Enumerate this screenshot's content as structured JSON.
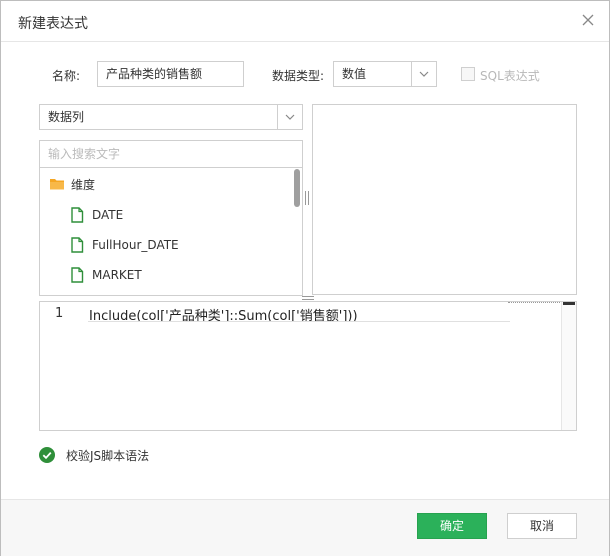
{
  "dialog": {
    "title": "新建表达式"
  },
  "form": {
    "name_label": "名称:",
    "name_value": "产品种类的销售额",
    "type_label": "数据类型:",
    "type_value": "数值",
    "sql_checkbox_label": "SQL表达式"
  },
  "source": {
    "selected": "数据列",
    "search_placeholder": "输入搜索文字"
  },
  "tree": {
    "folder": "维度",
    "items": [
      "DATE",
      "FullHour_DATE",
      "MARKET"
    ]
  },
  "editor": {
    "line_number": "1",
    "code": "Include(col['产品种类']::Sum(col['销售额']))"
  },
  "validate": {
    "label": "校验JS脚本语法"
  },
  "buttons": {
    "confirm": "确定",
    "cancel": "取消"
  },
  "colors": {
    "primary": "#2bb15a",
    "folder": "#f5a623",
    "doc": "#2f8f3a",
    "check": "#2f8f3a"
  }
}
